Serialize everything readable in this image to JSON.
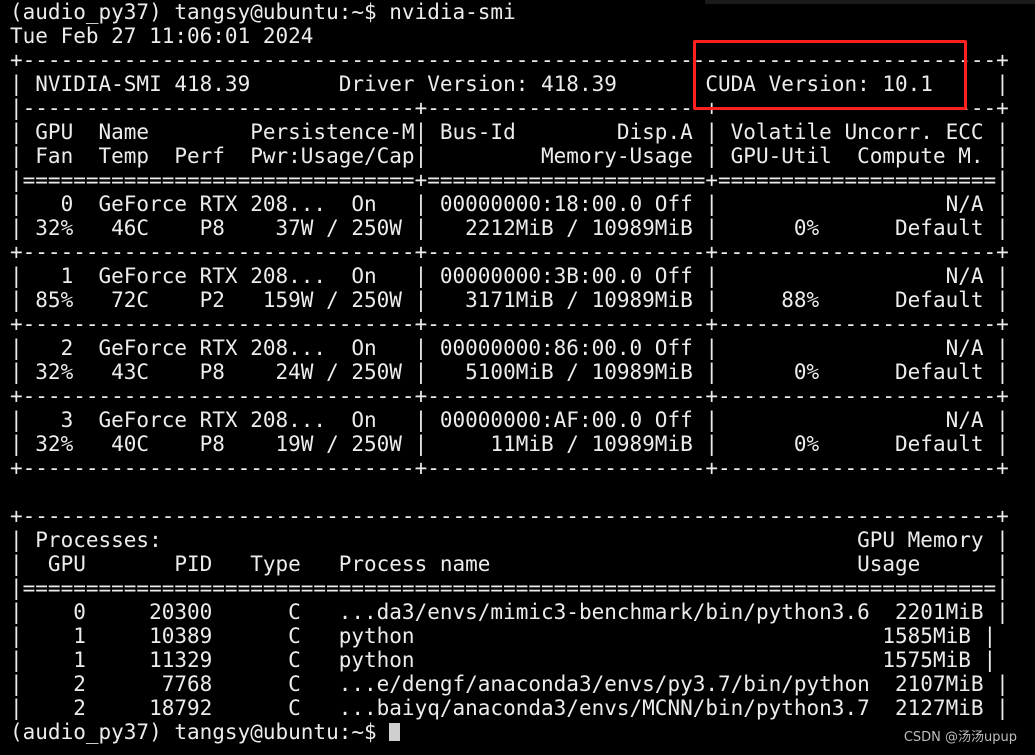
{
  "terminal": {
    "lines": [
      "(audio_py37) tangsy@ubuntu:~$ nvidia-smi",
      "Tue Feb 27 11:06:01 2024",
      "+-----------------------------------------------------------------------------+",
      "| NVIDIA-SMI 418.39       Driver Version: 418.39       CUDA Version: 10.1     |",
      "|-------------------------------+----------------------+----------------------+",
      "| GPU  Name        Persistence-M| Bus-Id        Disp.A | Volatile Uncorr. ECC |",
      "| Fan  Temp  Perf  Pwr:Usage/Cap|         Memory-Usage | GPU-Util  Compute M. |",
      "|===============================+======================+======================|",
      "|   0  GeForce RTX 208...  On   | 00000000:18:00.0 Off |                  N/A |",
      "| 32%   46C    P8    37W / 250W |   2212MiB / 10989MiB |      0%      Default |",
      "+-------------------------------+----------------------+----------------------+",
      "|   1  GeForce RTX 208...  On   | 00000000:3B:00.0 Off |                  N/A |",
      "| 85%   72C    P2   159W / 250W |   3171MiB / 10989MiB |     88%      Default |",
      "+-------------------------------+----------------------+----------------------+",
      "|   2  GeForce RTX 208...  On   | 00000000:86:00.0 Off |                  N/A |",
      "| 32%   43C    P8    24W / 250W |   5100MiB / 10989MiB |      0%      Default |",
      "+-------------------------------+----------------------+----------------------+",
      "|   3  GeForce RTX 208...  On   | 00000000:AF:00.0 Off |                  N/A |",
      "| 32%   40C    P8    19W / 250W |     11MiB / 10989MiB |      0%      Default |",
      "+-------------------------------+----------------------+----------------------+",
      "",
      "+-----------------------------------------------------------------------------+",
      "| Processes:                                                       GPU Memory |",
      "|  GPU       PID   Type   Process name                             Usage      |",
      "|=============================================================================|",
      "|    0     20300      C   ...da3/envs/mimic3-benchmark/bin/python3.6  2201MiB |",
      "|    1     10389      C   python                                     1585MiB |",
      "|    1     11329      C   python                                     1575MiB |",
      "|    2      7768      C   ...e/dengf/anaconda3/envs/py3.7/bin/python  2107MiB |",
      "|    2     18792      C   ...baiyq/anaconda3/envs/MCNN/bin/python3.7  2127MiB |"
    ],
    "prompt": "(audio_py37) tangsy@ubuntu:~$ "
  },
  "watermark": "CSDN @汤汤upup",
  "colors": {
    "background": "#000000",
    "text": "#ececec",
    "highlight": "#ff2020"
  }
}
